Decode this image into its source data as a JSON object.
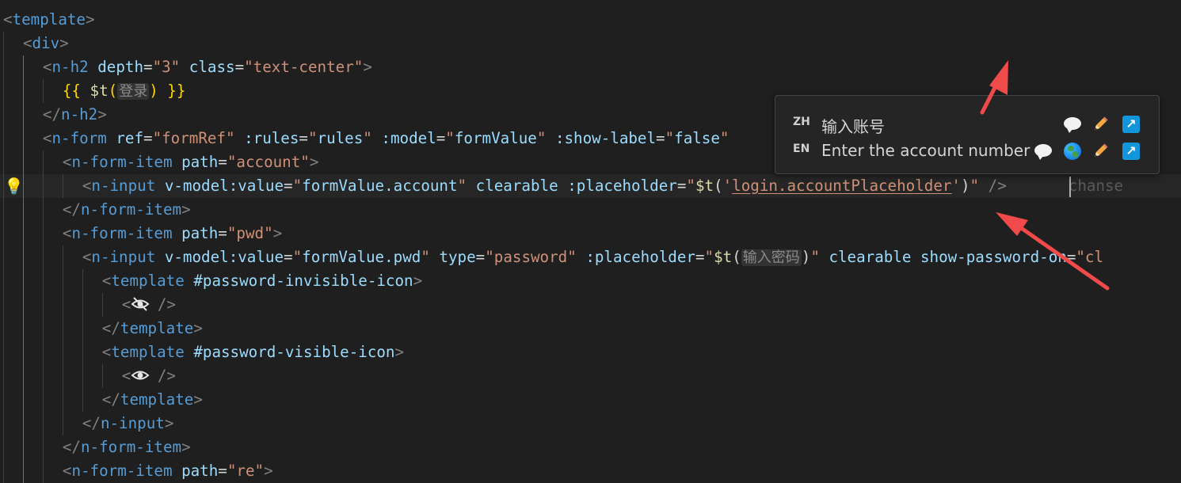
{
  "editor": {
    "lines": [
      {
        "tokens": [
          [
            "b",
            "<"
          ],
          [
            "t",
            "template"
          ],
          [
            "b",
            ">"
          ]
        ]
      },
      {
        "tokens": [
          [
            "b",
            "<"
          ],
          [
            "t",
            "div"
          ],
          [
            "b",
            ">"
          ]
        ]
      },
      {
        "tokens": [
          [
            "b",
            "<"
          ],
          [
            "t",
            "n-h2"
          ],
          [
            "p",
            " "
          ],
          [
            "a",
            "depth"
          ],
          [
            "p",
            "="
          ],
          [
            "s",
            "\"3\""
          ],
          [
            "p",
            " "
          ],
          [
            "a",
            "class"
          ],
          [
            "p",
            "="
          ],
          [
            "s",
            "\"text-center\""
          ],
          [
            "b",
            ">"
          ]
        ]
      },
      {
        "tokens": [
          [
            "m",
            "{{ "
          ],
          [
            "v",
            "$t"
          ],
          [
            "m",
            "("
          ]
        ]
      },
      {
        "tokens": [
          [
            "b",
            "</"
          ],
          [
            "t",
            "n-h2"
          ],
          [
            "b",
            ">"
          ]
        ]
      },
      {
        "tokens": [
          [
            "b",
            "<"
          ],
          [
            "t",
            "n-form"
          ],
          [
            "p",
            " "
          ],
          [
            "a",
            "ref"
          ],
          [
            "p",
            "="
          ],
          [
            "s",
            "\"formRef\""
          ],
          [
            "p",
            " "
          ],
          [
            "a",
            ":rules"
          ],
          [
            "p",
            "="
          ],
          [
            "s",
            "\""
          ],
          [
            "a",
            "rules"
          ],
          [
            "s",
            "\""
          ],
          [
            "p",
            " "
          ],
          [
            "a",
            ":model"
          ],
          [
            "p",
            "="
          ],
          [
            "s",
            "\""
          ],
          [
            "a",
            "formValue"
          ],
          [
            "s",
            "\""
          ],
          [
            "p",
            " "
          ],
          [
            "a",
            ":show-label"
          ],
          [
            "p",
            "="
          ],
          [
            "s",
            "\""
          ],
          [
            "a",
            "false"
          ],
          [
            "s",
            "\""
          ]
        ]
      },
      {
        "tokens": [
          [
            "b",
            "<"
          ],
          [
            "t",
            "n-form-item"
          ],
          [
            "p",
            " "
          ],
          [
            "a",
            "path"
          ],
          [
            "p",
            "="
          ],
          [
            "s",
            "\"account\""
          ],
          [
            "b",
            ">"
          ]
        ]
      },
      {
        "tokens": [
          [
            "b",
            "<"
          ],
          [
            "t",
            "n-input"
          ],
          [
            "p",
            " "
          ],
          [
            "a",
            "v-model:value"
          ],
          [
            "p",
            "="
          ],
          [
            "s",
            "\""
          ],
          [
            "a",
            "formValue.account"
          ],
          [
            "s",
            "\""
          ],
          [
            "p",
            " "
          ],
          [
            "a",
            "clearable"
          ],
          [
            "p",
            " "
          ],
          [
            "a",
            ":placeholder"
          ],
          [
            "p",
            "="
          ],
          [
            "s",
            "\""
          ],
          [
            "v",
            "$t"
          ],
          [
            "p",
            "("
          ],
          [
            "s",
            "'"
          ],
          [
            "k",
            "login.accountPlaceholder"
          ],
          [
            "s",
            "'"
          ],
          [
            "p",
            ")"
          ],
          [
            "s",
            "\""
          ],
          [
            "p",
            " "
          ],
          [
            "b",
            "/>"
          ]
        ]
      },
      {
        "tokens": [
          [
            "b",
            "</"
          ],
          [
            "t",
            "n-form-item"
          ],
          [
            "b",
            ">"
          ]
        ]
      },
      {
        "tokens": [
          [
            "b",
            "<"
          ],
          [
            "t",
            "n-form-item"
          ],
          [
            "p",
            " "
          ],
          [
            "a",
            "path"
          ],
          [
            "p",
            "="
          ],
          [
            "s",
            "\"pwd\""
          ],
          [
            "b",
            ">"
          ]
        ]
      },
      {
        "tokens": [
          [
            "b",
            "<"
          ],
          [
            "t",
            "n-input"
          ],
          [
            "p",
            " "
          ],
          [
            "a",
            "v-model:value"
          ],
          [
            "p",
            "="
          ],
          [
            "s",
            "\""
          ],
          [
            "a",
            "formValue.pwd"
          ],
          [
            "s",
            "\""
          ],
          [
            "p",
            " "
          ],
          [
            "a",
            "type"
          ],
          [
            "p",
            "="
          ],
          [
            "s",
            "\"password\""
          ],
          [
            "p",
            " "
          ],
          [
            "a",
            ":placeholder"
          ],
          [
            "p",
            "="
          ],
          [
            "s",
            "\""
          ],
          [
            "v",
            "$t"
          ],
          [
            "p",
            "("
          ]
        ]
      },
      {
        "tokens": [
          [
            "b",
            "<"
          ],
          [
            "t",
            "template"
          ],
          [
            "p",
            " "
          ],
          [
            "a",
            "#password-invisible-icon"
          ],
          [
            "b",
            ">"
          ]
        ]
      },
      {
        "tokens": [
          [
            "b",
            "<"
          ]
        ]
      },
      {
        "tokens": [
          [
            "b",
            "</"
          ],
          [
            "t",
            "template"
          ],
          [
            "b",
            ">"
          ]
        ]
      },
      {
        "tokens": [
          [
            "b",
            "<"
          ],
          [
            "t",
            "template"
          ],
          [
            "p",
            " "
          ],
          [
            "a",
            "#password-visible-icon"
          ],
          [
            "b",
            ">"
          ]
        ]
      },
      {
        "tokens": [
          [
            "b",
            "<"
          ]
        ]
      },
      {
        "tokens": [
          [
            "b",
            "</"
          ],
          [
            "t",
            "template"
          ],
          [
            "b",
            ">"
          ]
        ]
      },
      {
        "tokens": [
          [
            "b",
            "</"
          ],
          [
            "t",
            "n-input"
          ],
          [
            "b",
            ">"
          ]
        ]
      },
      {
        "tokens": [
          [
            "b",
            "</"
          ],
          [
            "t",
            "n-form-item"
          ],
          [
            "b",
            ">"
          ]
        ]
      },
      {
        "tokens": [
          [
            "b",
            "<"
          ],
          [
            "t",
            "n-form-item"
          ],
          [
            "p",
            " "
          ],
          [
            "a",
            "path"
          ],
          [
            "p",
            "="
          ],
          [
            "s",
            "\"re\""
          ],
          [
            "b",
            ">"
          ]
        ]
      }
    ],
    "line3_inlay": "登录",
    "line3_tail": ") }}",
    "line5_tail": ">",
    "line7_ghost": "chanse",
    "line10_inlay": "输入密码",
    "line10_tail": [
      [
        "p",
        ")"
      ],
      [
        "s",
        "\""
      ],
      [
        "p",
        " "
      ],
      [
        "a",
        "clearable"
      ],
      [
        "p",
        " "
      ],
      [
        "a",
        "show-password-on"
      ],
      [
        "p",
        "="
      ],
      [
        "s",
        "\"cl"
      ]
    ],
    "icon_line_tail": " />"
  },
  "popup": {
    "rows": [
      {
        "lang": "ZH",
        "text": "输入账号",
        "icons": [
          "comment-icon",
          "edit-pencil-icon",
          "open-external-icon"
        ]
      },
      {
        "lang": "EN",
        "text": "Enter the account number",
        "icons": [
          "comment-icon",
          "globe-icon",
          "edit-pencil-icon",
          "open-external-icon"
        ]
      }
    ]
  },
  "colors": {
    "annotation_arrow": "#f04a4a",
    "background": "#1f1f1f"
  }
}
